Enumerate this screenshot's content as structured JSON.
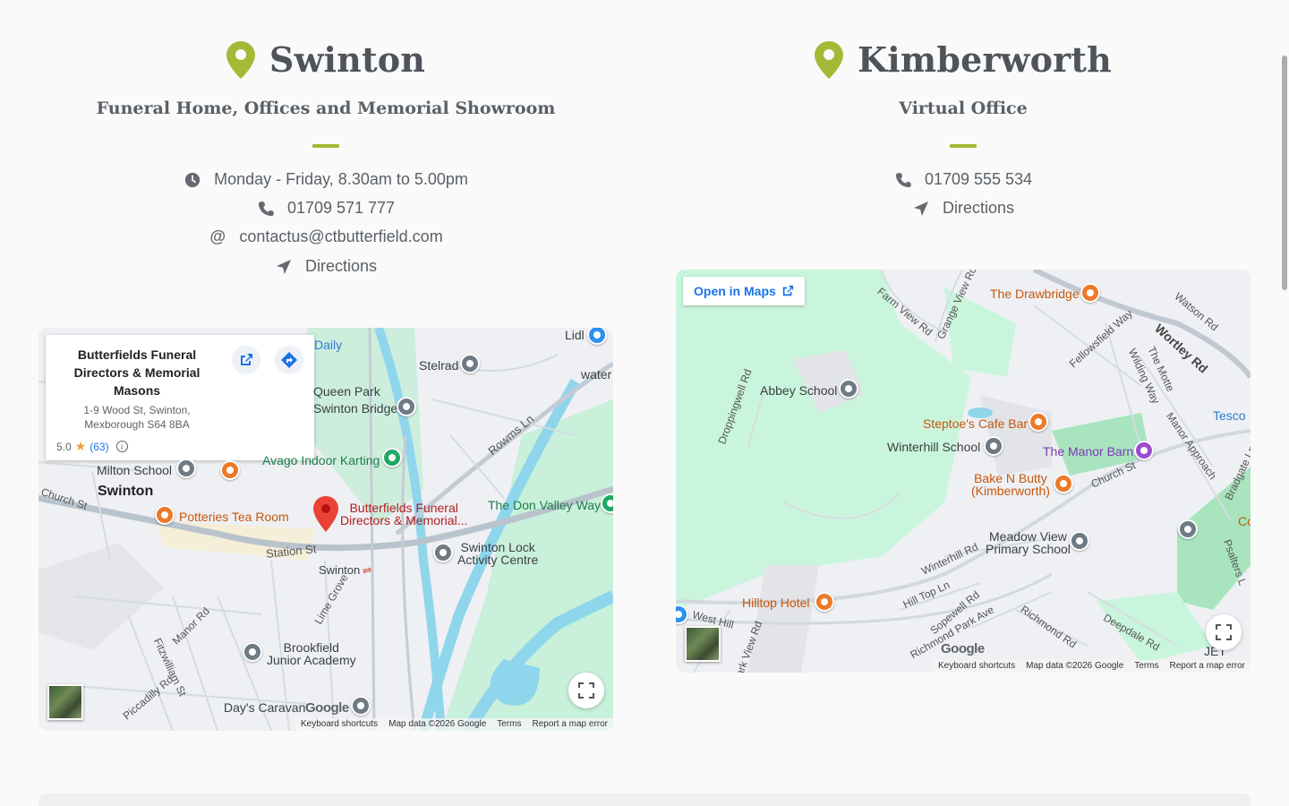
{
  "locations": [
    {
      "name": "Swinton",
      "subtitle": "Funeral Home, Offices and Memorial Showroom",
      "hours": "Monday - Friday, 8.30am to 5.00pm",
      "phone": "01709 571 777",
      "email": "contactus@ctbutterfield.com",
      "directions": "Directions",
      "map": {
        "card": {
          "name": "Butterfields Funeral Directors & Memorial Masons",
          "address_line1": "1-9 Wood St, Swinton,",
          "address_line2": "Mexborough S64 8BA",
          "rating": "5.0",
          "reviews": "(63)"
        },
        "labels": {
          "daily": "Daily",
          "lidl": "Lidl",
          "stelrad": "Stelrad",
          "water": "water",
          "queen_park": "Queen Park",
          "swinton_bridge": "Swinton Bridge",
          "avago": "Avago Indoor Karting",
          "milton": "Milton School",
          "swinton": "Swinton",
          "church_st": "Church St",
          "potteries": "Potteries Tea Room",
          "butterfields_1": "Butterfields Funeral",
          "butterfields_2": "Directors & Memorial...",
          "don_valley": "The Don Valley Way",
          "station_st": "Station St",
          "swinton_station": "Swinton",
          "swinton_lock_1": "Swinton Lock",
          "swinton_lock_2": "Activity Centre",
          "rowms_ln": "Rowms Ln",
          "lime_grove": "Lime Grove",
          "manor_rd": "Manor Rd",
          "fitzwilliam": "Fitzwilliam St",
          "piccadilly": "Piccadilly Rd",
          "brookfield_1": "Brookfield",
          "brookfield_2": "Junior Academy",
          "days_caravan": "Day's Caravan"
        },
        "attribution": [
          "Keyboard shortcuts",
          "Map data ©2026 Google",
          "Terms",
          "Report a map error"
        ],
        "logo": "Google"
      }
    },
    {
      "name": "Kimberworth",
      "subtitle": "Virtual Office",
      "phone": "01709 555 534",
      "directions": "Directions",
      "map": {
        "open_in_maps": "Open in Maps",
        "labels": {
          "drawbridge": "The Drawbridge",
          "farm_view": "Farm View Rd",
          "grange_view": "Grange View Rd",
          "watson": "Watson Rd",
          "fellowsfield": "Fellowsfield Way",
          "wortley": "Wortley Rd",
          "the_motte": "The Motte",
          "wilding": "Wilding Way",
          "abbey": "Abbey School",
          "droppingwell": "Droppingwell Rd",
          "tesco": "Tesco",
          "steptoes": "Steptoe's Cafe Bar",
          "winterhill": "Winterhill School",
          "manor_barn": "The Manor Barn",
          "manor_approach": "Manor Approach",
          "bake_1": "Bake N Butty",
          "bake_2": "(Kimberworth)",
          "church_st": "Church St",
          "bradgate": "Bradgate Ln",
          "meadow_1": "Meadow View",
          "meadow_2": "Primary School",
          "winterhill_rd": "Winterhill Rd",
          "psalters": "Psalters L",
          "hilltop": "Hilltop Hotel",
          "hill_top_ln": "Hill Top Ln",
          "sopewell": "Sopewell Rd",
          "west_hill": "West Hill",
          "richmond_park": "Richmond Park Ave",
          "richmond_rd": "Richmond Rd",
          "deepdale": "Deepdale Rd",
          "jet": "JET",
          "park_view": "Park View Rd",
          "co": "Co"
        },
        "attribution": [
          "Keyboard shortcuts",
          "Map data ©2026 Google",
          "Terms",
          "Report a map error"
        ],
        "logo": "Google"
      }
    }
  ],
  "colors": {
    "accent": "#a5b936",
    "text": "#5a6066",
    "heading": "#4e5459"
  }
}
